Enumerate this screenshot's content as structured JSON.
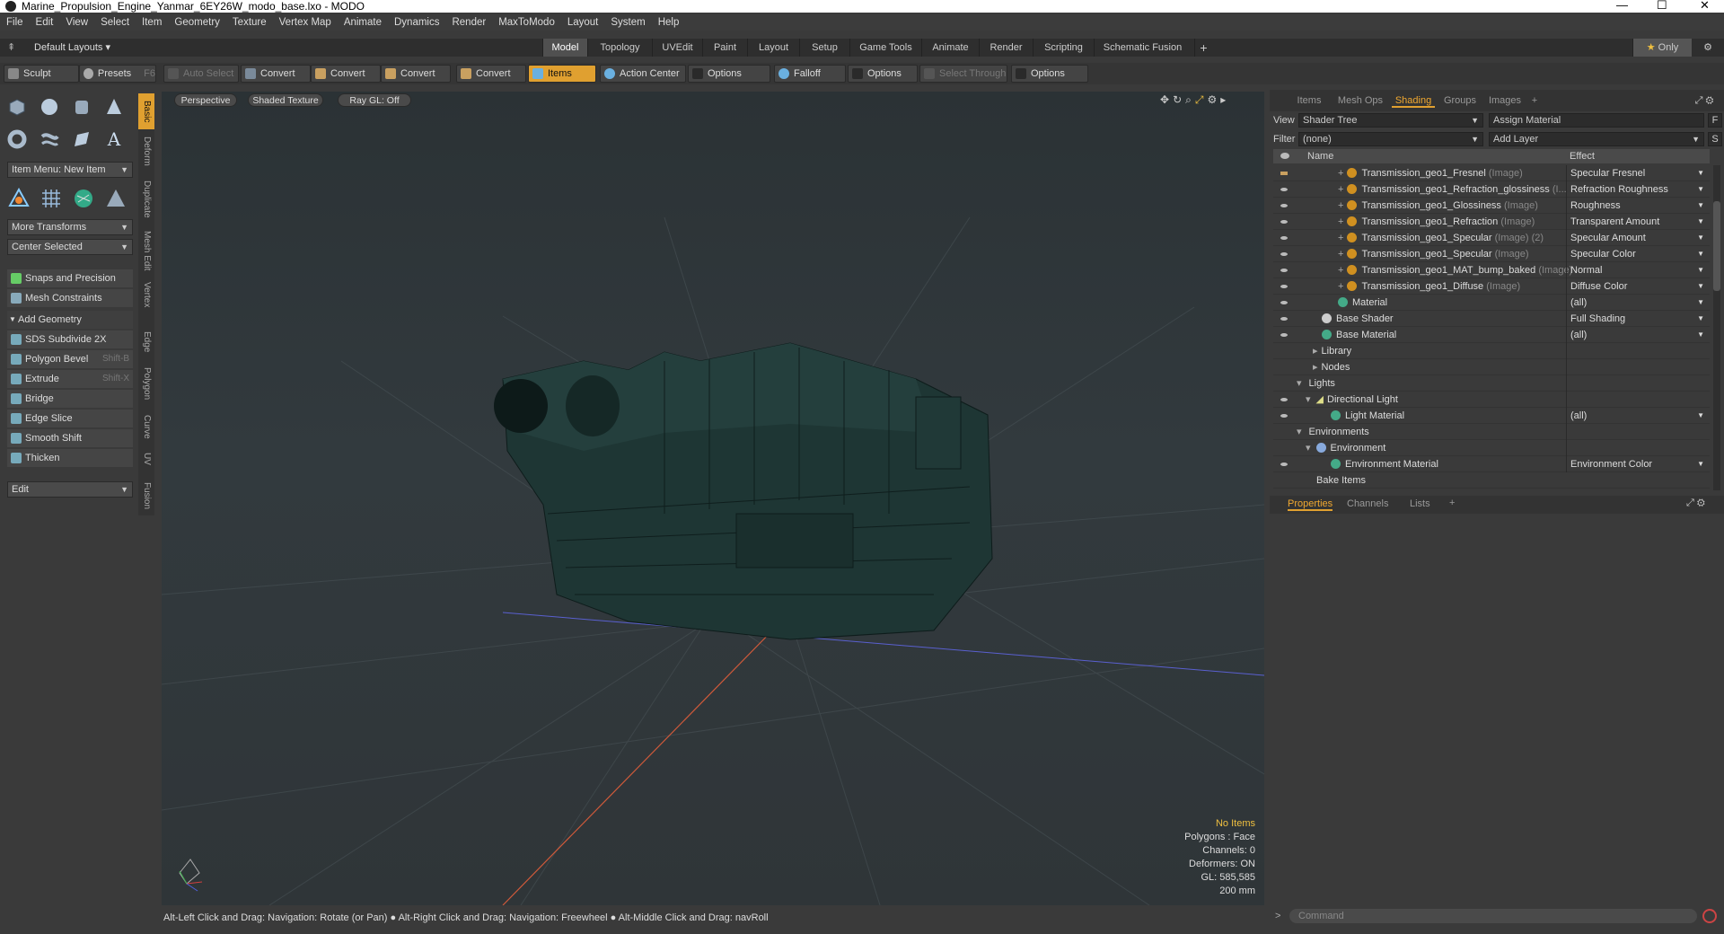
{
  "window": {
    "title": "Marine_Propulsion_Engine_Yanmar_6EY26W_modo_base.lxo - MODO"
  },
  "menu": [
    "File",
    "Edit",
    "View",
    "Select",
    "Item",
    "Geometry",
    "Texture",
    "Vertex Map",
    "Animate",
    "Dynamics",
    "Render",
    "MaxToModo",
    "Layout",
    "System",
    "Help"
  ],
  "layout_selector": "Default Layouts",
  "layout_tabs": [
    "Model",
    "Topology",
    "UVEdit",
    "Paint",
    "Layout",
    "Setup",
    "Game Tools",
    "Animate",
    "Render",
    "Scripting",
    "Schematic Fusion"
  ],
  "only_label": "Only",
  "toolbar": {
    "sculpt": "Sculpt",
    "presets": "Presets",
    "presets_key": "F6",
    "auto_select": "Auto Select",
    "convert": "Convert",
    "items": "Items",
    "action_center": "Action Center",
    "options": "Options",
    "falloff": "Falloff",
    "select_through": "Select Through"
  },
  "left": {
    "item_menu": "Item Menu: New Item",
    "more_transforms": "More Transforms",
    "center_selected": "Center Selected",
    "snaps": "Snaps and Precision",
    "mesh_constraints": "Mesh Constraints",
    "add_geometry": "Add Geometry",
    "tools": [
      {
        "label": "SDS Subdivide 2X",
        "key": ""
      },
      {
        "label": "Polygon Bevel",
        "key": "Shift-B"
      },
      {
        "label": "Extrude",
        "key": "Shift-X"
      },
      {
        "label": "Bridge",
        "key": ""
      },
      {
        "label": "Edge Slice",
        "key": ""
      },
      {
        "label": "Smooth Shift",
        "key": ""
      },
      {
        "label": "Thicken",
        "key": ""
      }
    ],
    "edit": "Edit",
    "vtabs": [
      "Basic",
      "Deform",
      "Duplicate",
      "Mesh Edit",
      "Vertex",
      "Edge",
      "Polygon",
      "Curve",
      "UV",
      "Fusion"
    ]
  },
  "viewport": {
    "view_mode": "Perspective",
    "shading": "Shaded Texture",
    "raygl": "Ray GL: Off",
    "hud": {
      "no_items": "No Items",
      "polygons": "Polygons : Face",
      "channels": "Channels: 0",
      "deformers": "Deformers: ON",
      "gl": "GL: 585,585",
      "scale": "200 mm"
    }
  },
  "status": "Alt-Left Click and Drag: Navigation: Rotate (or Pan) ●  Alt-Right Click and Drag: Navigation: Freewheel ●  Alt-Middle Click and Drag: navRoll",
  "right": {
    "tabs": [
      "Items",
      "Mesh Ops",
      "Shading",
      "Groups",
      "Images"
    ],
    "view_label": "View",
    "view_value": "Shader Tree",
    "assign_material": "Assign Material",
    "filter_label": "Filter",
    "filter_value": "(none)",
    "add_layer": "Add Layer",
    "col_name": "Name",
    "col_effect": "Effect",
    "rows": [
      {
        "name": "Transmission_geo1_Fresnel",
        "suffix": "(Image)",
        "effect": "Specular Fresnel"
      },
      {
        "name": "Transmission_geo1_Refraction_glossiness",
        "suffix": "(I...",
        "effect": "Refraction Roughness"
      },
      {
        "name": "Transmission_geo1_Glossiness",
        "suffix": "(Image)",
        "effect": "Roughness"
      },
      {
        "name": "Transmission_geo1_Refraction",
        "suffix": "(Image)",
        "effect": "Transparent Amount"
      },
      {
        "name": "Transmission_geo1_Specular",
        "suffix": "(Image) (2)",
        "effect": "Specular Amount"
      },
      {
        "name": "Transmission_geo1_Specular",
        "suffix": "(Image)",
        "effect": "Specular Color"
      },
      {
        "name": "Transmission_geo1_MAT_bump_baked",
        "suffix": "(Image)",
        "effect": "Normal"
      },
      {
        "name": "Transmission_geo1_Diffuse",
        "suffix": "(Image)",
        "effect": "Diffuse Color"
      },
      {
        "name": "Material",
        "suffix": "",
        "effect": "(all)"
      },
      {
        "name": "Base Shader",
        "suffix": "",
        "effect": "Full Shading"
      },
      {
        "name": "Base Material",
        "suffix": "",
        "effect": "(all)"
      },
      {
        "name": "Library",
        "suffix": "",
        "effect": ""
      },
      {
        "name": "Nodes",
        "suffix": "",
        "effect": ""
      },
      {
        "name": "Lights",
        "suffix": "",
        "effect": ""
      },
      {
        "name": "Directional Light",
        "suffix": "",
        "effect": ""
      },
      {
        "name": "Light Material",
        "suffix": "",
        "effect": "(all)"
      },
      {
        "name": "Environments",
        "suffix": "",
        "effect": ""
      },
      {
        "name": "Environment",
        "suffix": "",
        "effect": ""
      },
      {
        "name": "Environment Material",
        "suffix": "",
        "effect": "Environment Color"
      },
      {
        "name": "Bake Items",
        "suffix": "",
        "effect": ""
      }
    ],
    "bottom_tabs": [
      "Properties",
      "Channels",
      "Lists"
    ],
    "command_placeholder": "Command"
  },
  "colors": {
    "accent": "#e0a030",
    "engine": "#1f3a38",
    "bg_top": "#2b3235"
  }
}
